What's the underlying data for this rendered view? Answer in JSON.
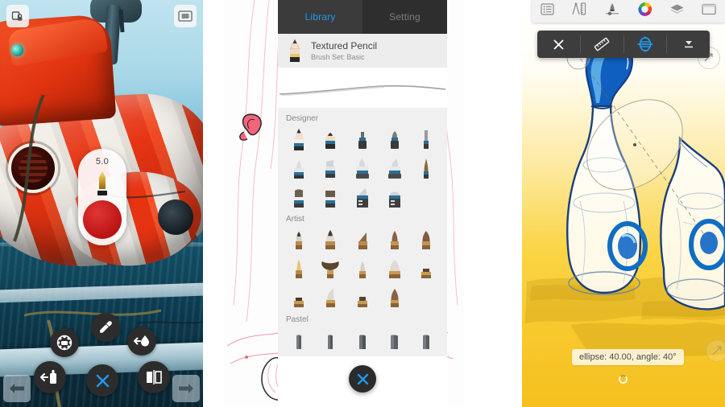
{
  "app": {
    "name": "Sketch drawing app",
    "panels": 3
  },
  "panel1": {
    "name": "canvas-with-radial-menu",
    "artwork_description": "Red and white striped rescue submarine / helicopter over blue sea",
    "top_left_button": {
      "icon": "layer-lock-icon",
      "label": "Lock layer"
    },
    "top_right_button": {
      "icon": "canvas-fullscreen-icon",
      "label": "Canvas"
    },
    "brush_widget": {
      "size_value": "5.0",
      "nib_icon": "pen-nib-icon",
      "color_swatch": "#c51a1a"
    },
    "radial_menu": [
      {
        "icon": "eraser-icon",
        "label": "Eraser"
      },
      {
        "icon": "eyedropper-icon",
        "label": "Color picker"
      },
      {
        "icon": "smudge-drop-icon",
        "label": "Smudge"
      },
      {
        "icon": "fill-bucket-icon",
        "label": "Fill"
      },
      {
        "icon": "close-x-icon",
        "label": "Close menu"
      },
      {
        "icon": "symmetry-mirror-icon",
        "label": "Symmetry"
      }
    ],
    "undo_button": {
      "icon": "undo-arrow-icon",
      "label": "Undo"
    },
    "redo_button": {
      "icon": "redo-arrow-icon",
      "label": "Redo"
    }
  },
  "panel2": {
    "name": "brush-library-panel",
    "artwork_description": "Pink and white line-art sketch behind panel",
    "tabs": [
      {
        "label": "Library",
        "active": true
      },
      {
        "label": "Setting",
        "active": false
      }
    ],
    "current_brush": {
      "icon": "pencil-icon",
      "name": "Textured Pencil",
      "set_label": "Brush Set: Basic"
    },
    "groups": [
      {
        "title": "Designer",
        "brushes": [
          {
            "icon": "pencil-sharp-icon",
            "type": "pencil"
          },
          {
            "icon": "pencil-blunt-icon",
            "type": "pencil"
          },
          {
            "icon": "marker-small-icon",
            "type": "marker"
          },
          {
            "icon": "marker-round-icon",
            "type": "marker"
          },
          {
            "icon": "liner-thin-icon",
            "type": "liner"
          },
          {
            "icon": "airbrush-icon",
            "type": "airbrush"
          },
          {
            "icon": "wedge-marker-icon",
            "type": "marker"
          },
          {
            "icon": "chisel-marker-icon",
            "type": "marker"
          },
          {
            "icon": "angled-marker-icon",
            "type": "marker"
          },
          {
            "icon": "fine-liner-icon",
            "type": "liner"
          },
          {
            "icon": "flat-brush-icon",
            "type": "brush"
          },
          {
            "icon": "square-brush-icon",
            "type": "brush"
          },
          {
            "icon": "fan-chisel-icon",
            "type": "brush"
          },
          {
            "icon": "dome-brush-icon",
            "type": "brush"
          }
        ]
      },
      {
        "title": "Artist",
        "brushes": [
          {
            "icon": "round-sable-icon",
            "type": "brush"
          },
          {
            "icon": "pointed-sable-icon",
            "type": "brush"
          },
          {
            "icon": "angled-wood-icon",
            "type": "brush"
          },
          {
            "icon": "round-wood-icon",
            "type": "brush"
          },
          {
            "icon": "filbert-icon",
            "type": "brush"
          },
          {
            "icon": "rigger-icon",
            "type": "brush"
          },
          {
            "icon": "fan-brush-icon",
            "type": "brush"
          },
          {
            "icon": "small-round-icon",
            "type": "brush"
          },
          {
            "icon": "mop-brush-icon",
            "type": "brush"
          },
          {
            "icon": "stubby-flat-icon",
            "type": "brush"
          },
          {
            "icon": "short-flat-icon",
            "type": "brush"
          },
          {
            "icon": "sword-liner-icon",
            "type": "brush"
          },
          {
            "icon": "flat-wood-icon",
            "type": "brush"
          },
          {
            "icon": "cone-brush-icon",
            "type": "brush"
          }
        ]
      },
      {
        "title": "Pastel",
        "brushes": [
          {
            "icon": "pastel-stick-icon",
            "type": "pastel"
          },
          {
            "icon": "pastel-stick-icon",
            "type": "pastel"
          },
          {
            "icon": "pastel-stick-icon",
            "type": "pastel"
          },
          {
            "icon": "pastel-stick-icon",
            "type": "pastel"
          },
          {
            "icon": "pastel-stick-icon",
            "type": "pastel"
          }
        ]
      }
    ],
    "close_button": {
      "icon": "close-x-icon",
      "label": "Close"
    }
  },
  "panel3": {
    "name": "ellipse-guide-panel",
    "artwork_description": "Blue capped bottles on yellow background with shadows",
    "top_toolbar": [
      {
        "icon": "list-menu-icon",
        "label": "Menu"
      },
      {
        "icon": "compass-ruler-icon",
        "label": "Tools"
      },
      {
        "icon": "brush-settings-icon",
        "label": "Brush"
      },
      {
        "icon": "color-wheel-icon",
        "label": "Color"
      },
      {
        "icon": "layers-icon",
        "label": "Layers"
      },
      {
        "icon": "canvas-icon",
        "label": "Canvas"
      }
    ],
    "guide_toolbar": [
      {
        "icon": "close-x-icon",
        "label": "Close guide"
      },
      {
        "icon": "ruler-icon",
        "label": "Ruler"
      },
      {
        "icon": "ellipse-guide-icon",
        "label": "Ellipse guide",
        "active": true
      },
      {
        "icon": "chevron-down-icon",
        "label": "More options"
      }
    ],
    "tooltip": "ellipse: 40.00, angle: 40°",
    "ellipse": {
      "size": "40.00",
      "angle": "40°"
    },
    "rotate_handle": {
      "icon": "rotate-handle-icon",
      "label": "Rotate"
    }
  },
  "colors": {
    "accent_blue": "#1e9af0",
    "toolbar_dark": "#3d3d3d",
    "tab_bar": "#3b3b3b",
    "panel_bg": "#f0f0f0",
    "brush_red": "#c51a1a",
    "canvas_yellow": "#f8c92e"
  }
}
